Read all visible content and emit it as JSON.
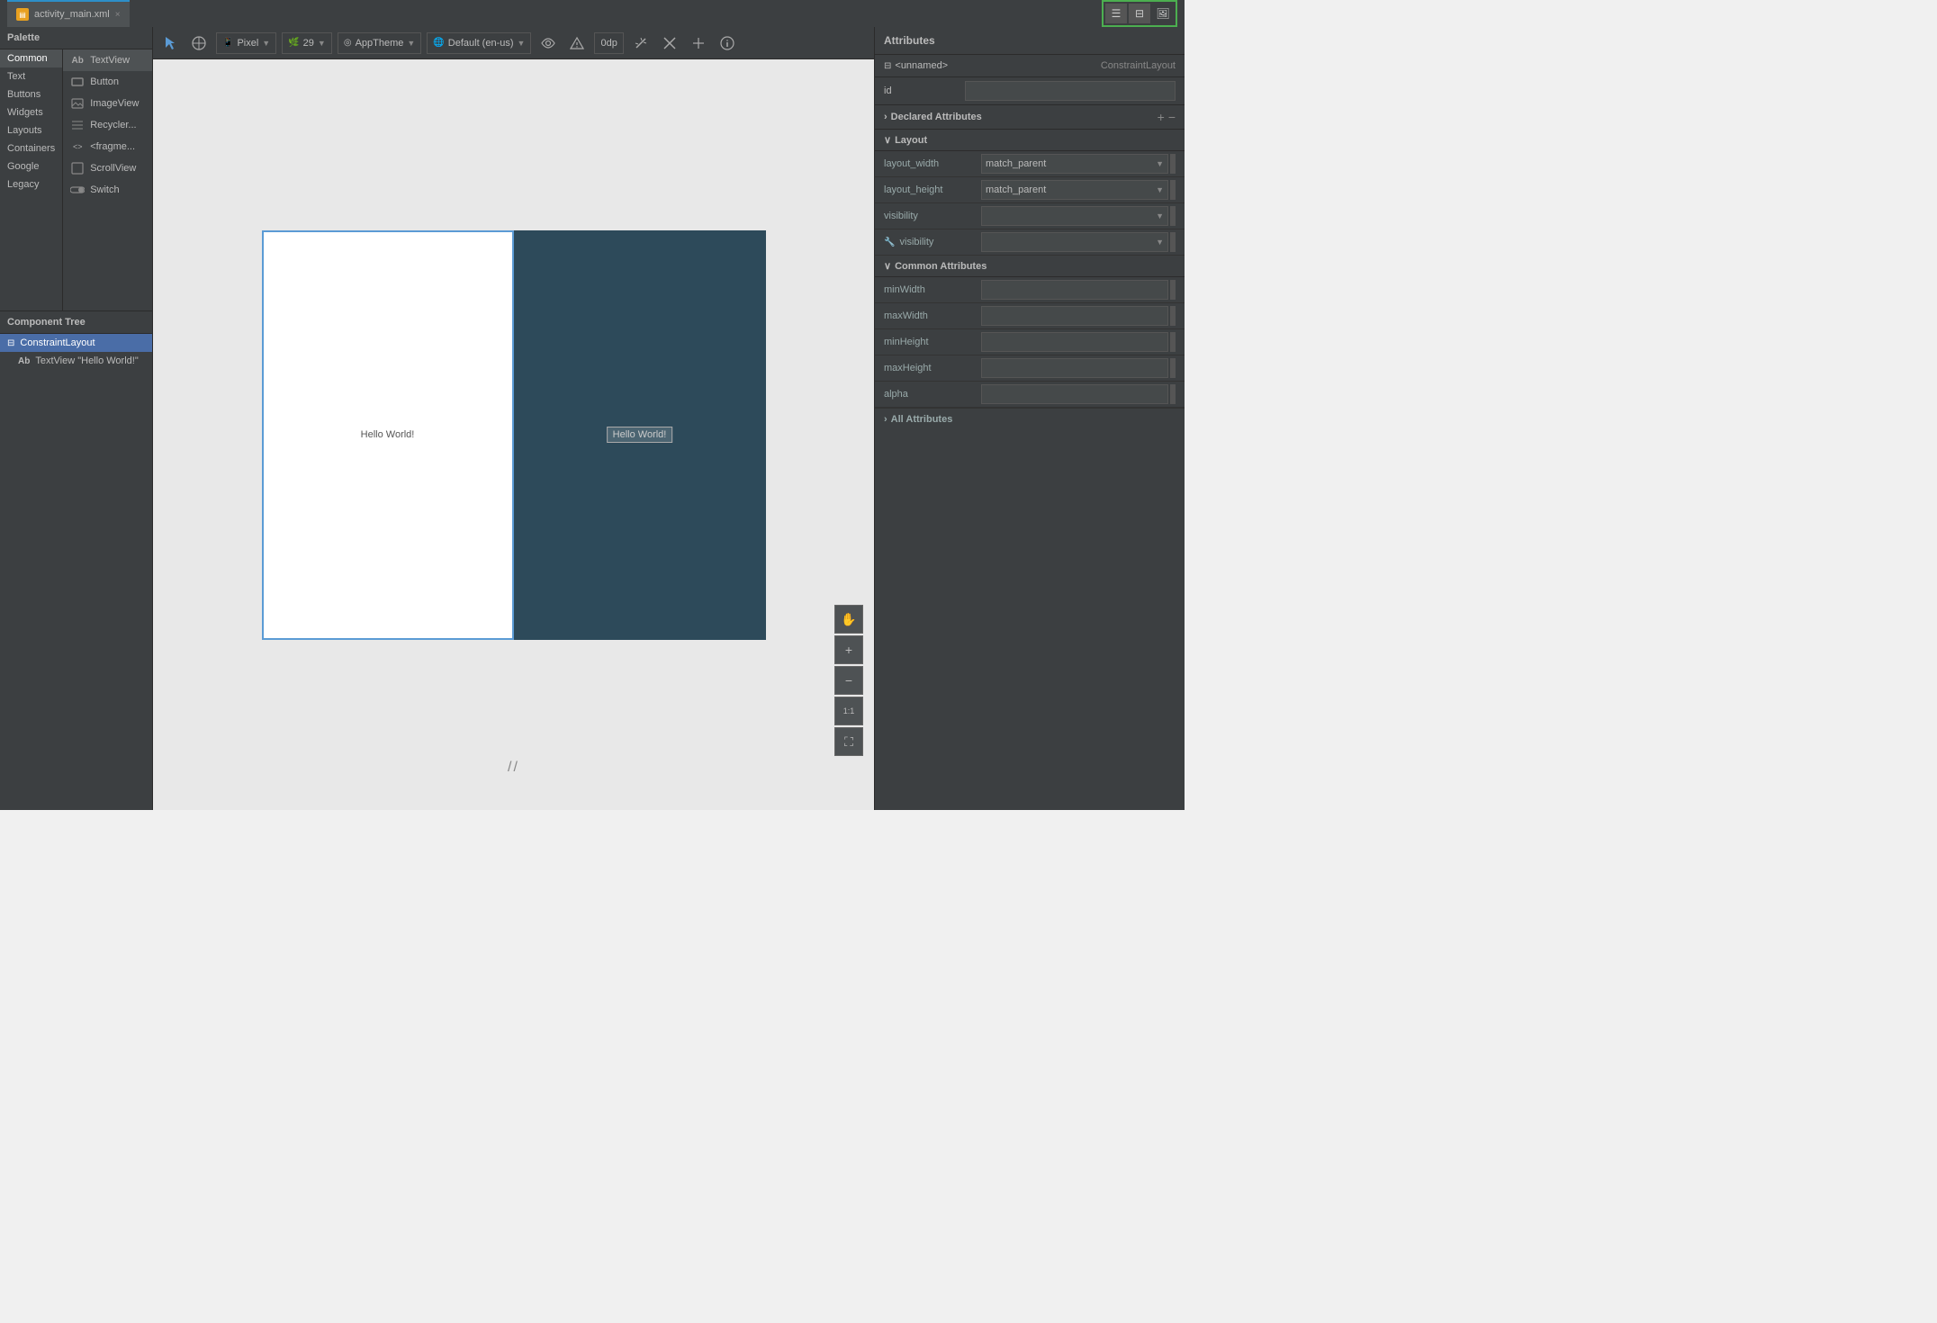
{
  "tab": {
    "label": "activity_main.xml",
    "close": "×"
  },
  "top_icons": [
    {
      "name": "list-icon",
      "symbol": "☰"
    },
    {
      "name": "split-icon",
      "symbol": "⊞"
    },
    {
      "name": "image-icon",
      "symbol": "🖼"
    }
  ],
  "palette": {
    "header": "Palette",
    "categories": [
      {
        "label": "Common",
        "active": true
      },
      {
        "label": "Text"
      },
      {
        "label": "Buttons"
      },
      {
        "label": "Widgets"
      },
      {
        "label": "Layouts"
      },
      {
        "label": "Containers"
      },
      {
        "label": "Google"
      },
      {
        "label": "Legacy"
      }
    ],
    "items": [
      {
        "icon": "Ab",
        "label": "TextView",
        "selected": true
      },
      {
        "icon": "□",
        "label": "Button"
      },
      {
        "icon": "🖼",
        "label": "ImageView"
      },
      {
        "icon": "≡",
        "label": "Recycler..."
      },
      {
        "icon": "<>",
        "label": "<fragme..."
      },
      {
        "icon": "□",
        "label": "ScrollView"
      },
      {
        "icon": "◉",
        "label": "Switch"
      }
    ]
  },
  "component_tree": {
    "header": "Component Tree",
    "items": [
      {
        "label": "ConstraintLayout",
        "indent": 0,
        "icon": "⊞",
        "selected": true
      },
      {
        "label": "TextView  \"Hello World!\"",
        "indent": 1,
        "icon": "Ab",
        "selected": false
      }
    ]
  },
  "toolbar": {
    "device": "Pixel",
    "api": "29",
    "theme": "AppTheme",
    "locale": "Default (en-us)",
    "margin": "0dp"
  },
  "canvas": {
    "hello_world": "Hello World!",
    "hello_world_dark": "Hello World!"
  },
  "canvas_controls": [
    {
      "name": "hand-icon",
      "symbol": "✋"
    },
    {
      "name": "zoom-in-icon",
      "symbol": "+"
    },
    {
      "name": "zoom-out-icon",
      "symbol": "−"
    },
    {
      "name": "ratio-icon",
      "symbol": "1:1"
    },
    {
      "name": "fit-icon",
      "symbol": "⛶"
    }
  ],
  "attributes": {
    "header": "Attributes",
    "component_name": "<unnamed>",
    "component_type": "ConstraintLayout",
    "id_label": "id",
    "id_value": "",
    "sections": {
      "declared": {
        "title": "Declared Attributes",
        "collapsed": false,
        "add_icon": "+",
        "remove_icon": "−"
      },
      "layout": {
        "title": "Layout",
        "collapsed": false,
        "fields": [
          {
            "label": "layout_width",
            "value": "match_parent",
            "type": "dropdown"
          },
          {
            "label": "layout_height",
            "value": "match_parent",
            "type": "dropdown"
          },
          {
            "label": "visibility",
            "value": "",
            "type": "dropdown"
          },
          {
            "label": "visibility",
            "value": "",
            "type": "dropdown",
            "wrench": true
          }
        ]
      },
      "common": {
        "title": "Common Attributes",
        "collapsed": false,
        "fields": [
          {
            "label": "minWidth",
            "value": "",
            "type": "input"
          },
          {
            "label": "maxWidth",
            "value": "",
            "type": "input"
          },
          {
            "label": "minHeight",
            "value": "",
            "type": "input"
          },
          {
            "label": "maxHeight",
            "value": "",
            "type": "input"
          },
          {
            "label": "alpha",
            "value": "",
            "type": "input"
          }
        ]
      },
      "all": {
        "title": "All Attributes"
      }
    }
  }
}
